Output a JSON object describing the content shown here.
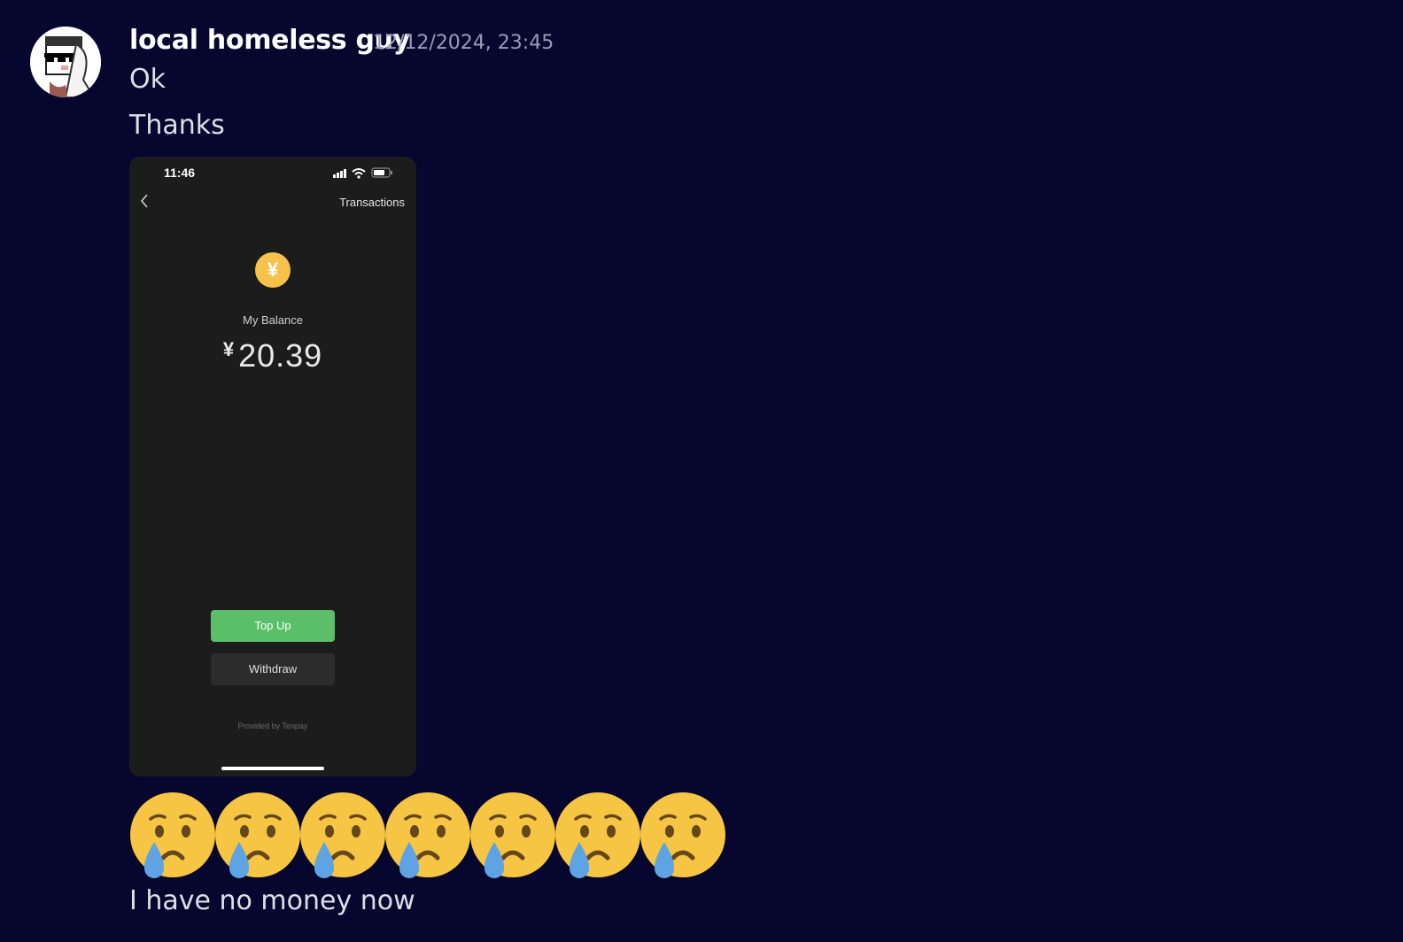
{
  "message": {
    "author": "local homeless guy",
    "timestamp": "12/12/2024, 23:45",
    "lines": [
      "Ok",
      "Thanks",
      "I have no money now"
    ]
  },
  "attachment": {
    "status_time": "11:46",
    "header_link": "Transactions",
    "coin_symbol": "¥",
    "balance_label": "My Balance",
    "currency": "¥",
    "balance_value": "20.39",
    "topup_label": "Top Up",
    "withdraw_label": "Withdraw",
    "provider_text": "Provided by Tenpay"
  },
  "emoji": {
    "name": "crying-face-emoji",
    "count": 7
  },
  "colors": {
    "background": "#06062e",
    "topup_green": "#5bbf6a",
    "coin_yellow": "#f7c24a"
  }
}
